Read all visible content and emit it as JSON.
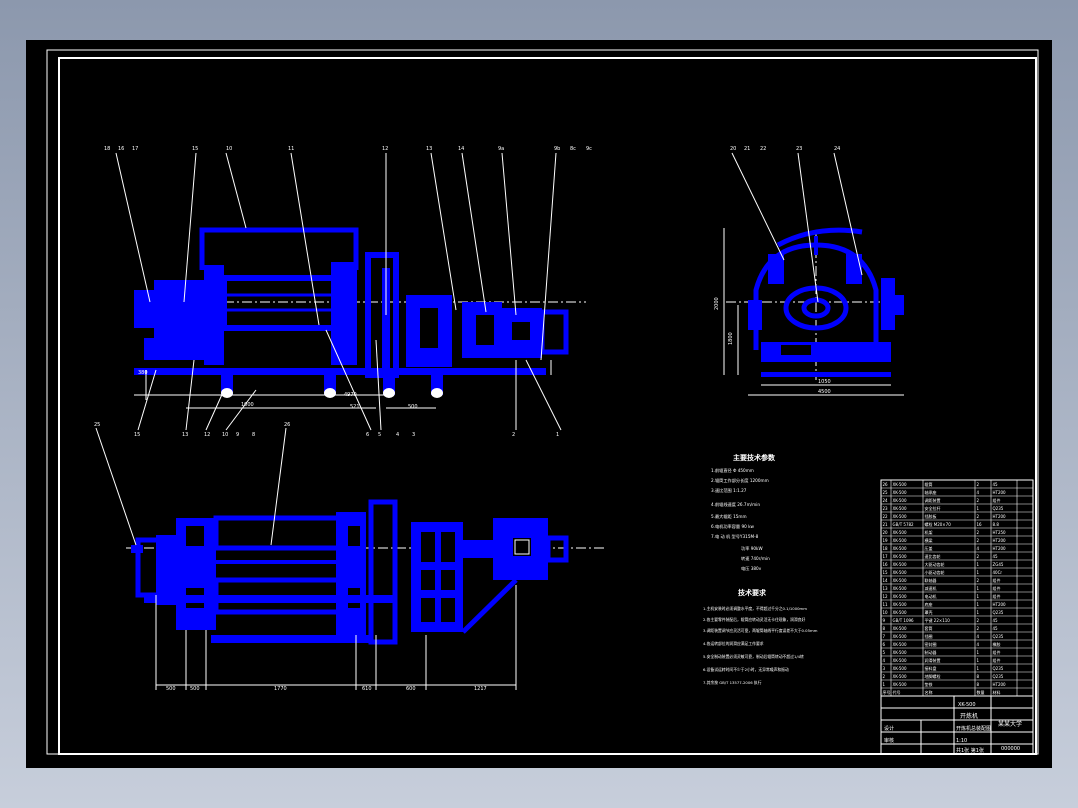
{
  "drawing": {
    "callouts_front": [
      "18",
      "16",
      "17",
      "15",
      "10",
      "11",
      "12",
      "13",
      "14",
      "9a",
      "9b",
      "8c",
      "9c",
      "6b",
      "7b",
      "8b"
    ],
    "callouts_lower": [
      "15",
      "13",
      "12",
      "10",
      "9",
      "8",
      "6",
      "5",
      "4",
      "3",
      "2",
      "1"
    ],
    "callouts_side": [
      "20",
      "21",
      "22",
      "23",
      "24"
    ],
    "callouts_plan": [
      "25",
      "26"
    ],
    "dimensions_front": [
      "380",
      "1000",
      "4970",
      "521",
      "500"
    ],
    "dimensions_side": [
      "2000",
      "1800",
      "1050",
      "4500"
    ],
    "dimensions_plan": [
      "500",
      "500",
      "1770",
      "610",
      "600",
      "1217"
    ]
  },
  "notes": {
    "params_title": "主要技术参数",
    "params": [
      "1.前辊直径  Φ 450mm",
      "2.辊筒工作部分长度    1200mm",
      "3.速比范围     1:1.27",
      "4.前辊线速度      26.7m/min",
      "5.最大辊距      15mm",
      "6.电机功率容量      90 kw",
      "7.电 动 机     型号Y315M-8"
    ],
    "motor_specs": [
      "功率  90kW",
      "转速 740r/min",
      "电压  380v"
    ],
    "req_title": "技术要求",
    "requirements": [
      "1.主机安装时必须调整水平度，不得超过千分之0.1/1000mm",
      "2.各主要零件装配后，辊筒应转动灵活无卡住现象，润滑良好",
      "3.调距装置调节应灵活可靠，两辊筒轴线平行度误差不大于0.05mm",
      "4.各运转部位的润滑应满足工作要求",
      "5.安全制动装置必须灵敏可靠，制动后辊筒转动不超过1/4转",
      "6.设备试运转时间不少于2小时，无异常噪声和振动",
      "7.其余按 GB/T 13577-2006 执行"
    ]
  },
  "bom": {
    "rows": [
      [
        "26",
        "XK-500",
        "辊筒",
        "2",
        "45"
      ],
      [
        "25",
        "XK-500",
        "轴承座",
        "4",
        "HT200"
      ],
      [
        "24",
        "XK-500",
        "调距装置",
        "2",
        "组件"
      ],
      [
        "23",
        "XK-500",
        "安全拉杆",
        "1",
        "Q235"
      ],
      [
        "22",
        "XK-500",
        "挡胶板",
        "2",
        "HT200"
      ],
      [
        "21",
        "GB/T 5782",
        "螺栓 M20×70",
        "16",
        "8.8"
      ],
      [
        "20",
        "XK-500",
        "机架",
        "2",
        "HT250"
      ],
      [
        "19",
        "XK-500",
        "横梁",
        "2",
        "HT200"
      ],
      [
        "18",
        "XK-500",
        "压盖",
        "4",
        "HT200"
      ],
      [
        "17",
        "XK-500",
        "速比齿轮",
        "2",
        "45"
      ],
      [
        "16",
        "XK-500",
        "大驱动齿轮",
        "1",
        "ZG45"
      ],
      [
        "15",
        "XK-500",
        "小驱动齿轮",
        "1",
        "40Cr"
      ],
      [
        "14",
        "XK-500",
        "联轴器",
        "2",
        "组件"
      ],
      [
        "13",
        "XK-500",
        "减速机",
        "1",
        "组件"
      ],
      [
        "12",
        "XK-500",
        "电动机",
        "1",
        "组件"
      ],
      [
        "11",
        "XK-500",
        "底座",
        "1",
        "HT200"
      ],
      [
        "10",
        "XK-500",
        "罩壳",
        "1",
        "Q235"
      ],
      [
        "9",
        "GB/T 1096",
        "平键 22×110",
        "2",
        "45"
      ],
      [
        "8",
        "XK-500",
        "套筒",
        "2",
        "45"
      ],
      [
        "7",
        "XK-500",
        "挡圈",
        "4",
        "Q235"
      ],
      [
        "6",
        "XK-500",
        "密封圈",
        "4",
        "橡胶"
      ],
      [
        "5",
        "XK-500",
        "制动器",
        "1",
        "组件"
      ],
      [
        "4",
        "XK-500",
        "润滑装置",
        "1",
        "组件"
      ],
      [
        "3",
        "XK-500",
        "接料盘",
        "1",
        "Q235"
      ],
      [
        "2",
        "XK-500",
        "地脚螺栓",
        "8",
        "Q235"
      ],
      [
        "1",
        "XK-500",
        "垫铁",
        "8",
        "HT200"
      ]
    ],
    "header": [
      "序号",
      "代号",
      "名称",
      "数量",
      "材料"
    ]
  },
  "title_block": {
    "drawing_no": "XK-500",
    "name": "开炼机",
    "subtitle": "开炼机总装配图",
    "school": "某某大学",
    "scale": "1:10",
    "sheet": "共1张 第1张",
    "designer": "设计",
    "checker": "审核",
    "code": "000000"
  }
}
